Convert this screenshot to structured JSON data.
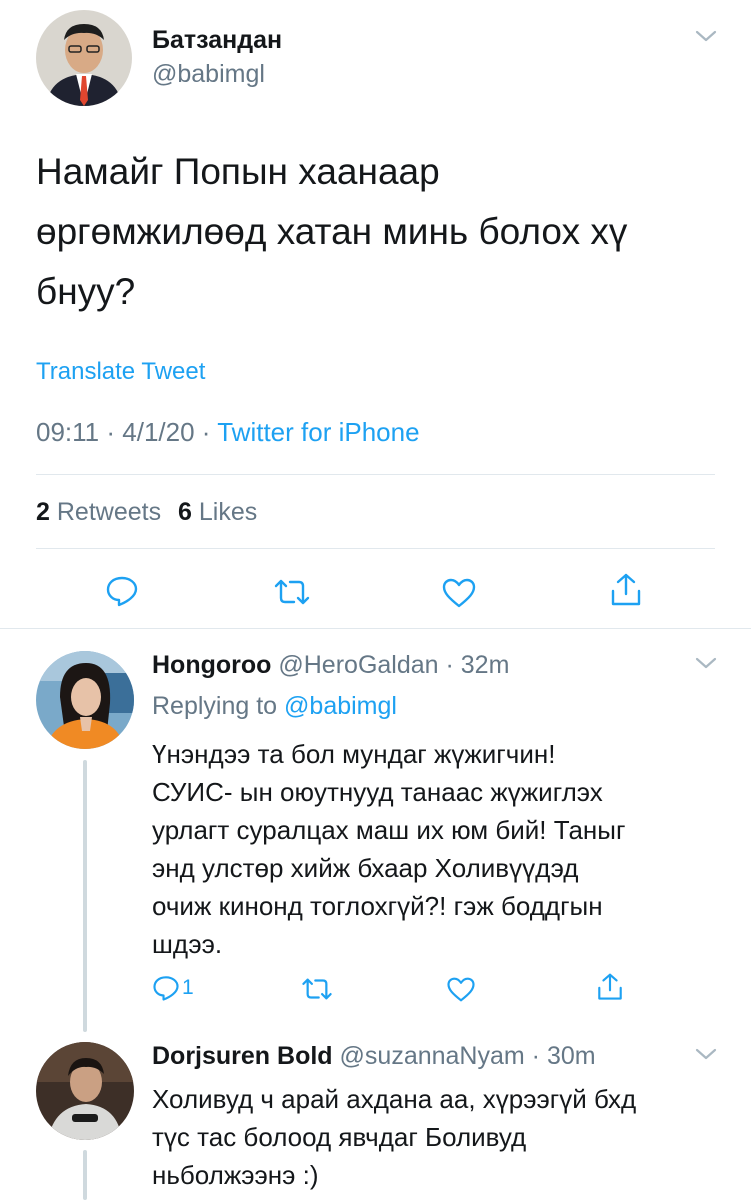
{
  "main_tweet": {
    "author_name": "Батзандан",
    "author_handle": "@babimgl",
    "text_lines": [
      "Намайг Попын хаанаар",
      "өргөмжилөөд хатан минь болох хү",
      "бнуу?"
    ],
    "translate_label": "Translate Tweet",
    "time": "09:11",
    "date": "4/1/20",
    "source": "Twitter for iPhone",
    "retweet_count": "2",
    "retweet_label": "Retweets",
    "like_count": "6",
    "like_label": "Likes"
  },
  "replies": [
    {
      "author_name": "Hongoroo",
      "author_handle": "@HeroGaldan",
      "time": "32m",
      "replying_prefix": "Replying to",
      "replying_handle": "@babimgl",
      "text_lines": [
        "Үнэндээ та бол мундаг жүжигчин!",
        "СУИС- ын оюутнууд танаас жүжиглэх",
        "урлагт суралцах маш их юм бий! Таныг",
        "энд улстөр хийж бхаар Холивүүдэд",
        "очиж кинонд тоглохгүй?! гэж боддгын",
        "шдээ."
      ],
      "reply_count": "1"
    },
    {
      "author_name": "Dorjsuren Bold",
      "author_handle": "@suzannaNyam",
      "time": "30m",
      "text_lines": [
        "Холивуд ч арай ахдана аа, хүрээгүй бхд",
        "түс тас болоод явчдаг Боливуд",
        "ньболжээнэ :)"
      ]
    }
  ],
  "colors": {
    "link": "#1da1f2",
    "muted": "#657786",
    "divider": "#e1e8ed",
    "icon": "#1da1f2"
  },
  "icons": [
    "chevron-down-icon",
    "reply-icon",
    "retweet-icon",
    "like-icon",
    "share-icon"
  ]
}
